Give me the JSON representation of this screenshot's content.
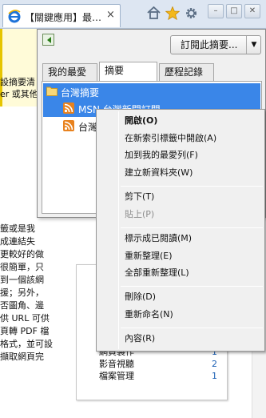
{
  "browser": {
    "tab_title": "【關鍵應用】最…",
    "tab_close": "×",
    "window_buttons": {
      "minimize": "–",
      "maximize": "□",
      "close": "✕"
    },
    "icons": [
      "ie-logo-icon",
      "home-icon",
      "star-icon",
      "gear-icon"
    ]
  },
  "page": {
    "top_lines": [
      "設摘要清",
      "er 或其他"
    ],
    "body_lines": [
      "籤或是我",
      "成連結失",
      "更較好的做",
      "很簡單，只",
      "到一個該網",
      "援；另外，",
      "否圖角、邊",
      "供 URL 可供",
      "頁轉 PDF 檔",
      "格式，並可設",
      "擷取網頁完"
    ],
    "categories": [
      {
        "name": "網頁製作",
        "count": "1"
      },
      {
        "name": "影音視聽",
        "count": "2"
      },
      {
        "name": "檔案管理",
        "count": "1"
      }
    ]
  },
  "favorites_panel": {
    "subscribe_label": "訂閱此摘要...",
    "subscribe_arrow": "▼",
    "tabs": [
      {
        "label": "我的最愛"
      },
      {
        "label": "摘要"
      },
      {
        "label": "歷程記錄"
      }
    ],
    "tree": {
      "folder": "台灣摘要",
      "feeds": [
        "MSN 台灣新聞訂閱",
        "台灣"
      ]
    }
  },
  "context_menu": {
    "items": [
      {
        "label": "開啟(O)",
        "bold": true,
        "disabled": false
      },
      {
        "label": "在新索引標籤中開啟(A)",
        "bold": false,
        "disabled": false
      },
      {
        "label": "加到我的最愛列(F)",
        "bold": false,
        "disabled": false
      },
      {
        "label": "建立新資料夾(W)",
        "bold": false,
        "disabled": false
      },
      {
        "label": "剪下(T)",
        "bold": false,
        "disabled": false
      },
      {
        "label": "貼上(P)",
        "bold": false,
        "disabled": true
      },
      {
        "label": "標示成已閱讀(M)",
        "bold": false,
        "disabled": false
      },
      {
        "label": "重新整理(E)",
        "bold": false,
        "disabled": false
      },
      {
        "label": "全部重新整理(L)",
        "bold": false,
        "disabled": false
      },
      {
        "label": "刪除(D)",
        "bold": false,
        "disabled": false
      },
      {
        "label": "重新命名(N)",
        "bold": false,
        "disabled": false
      },
      {
        "label": "內容(R)",
        "bold": false,
        "disabled": false
      }
    ]
  },
  "colors": {
    "selection": "#3a86e8",
    "rss_orange": "#e8821e",
    "link_blue": "#1a5fb4"
  }
}
